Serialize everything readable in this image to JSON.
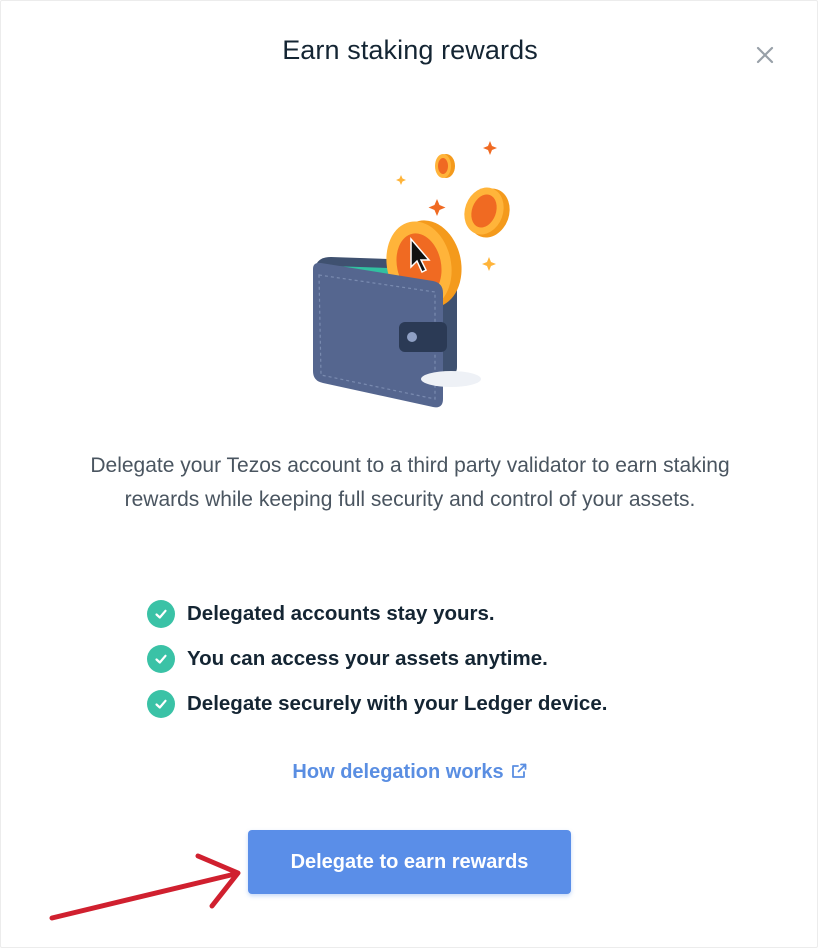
{
  "modal": {
    "title": "Earn staking rewards",
    "close_icon": "close-icon",
    "illustration_icon": "wallet-with-coins-icon",
    "description": "Delegate your Tezos account to a third party validator to earn staking rewards while keeping full security and control of your assets.",
    "features": [
      {
        "label": "Delegated accounts stay yours.",
        "icon": "check-circle-icon"
      },
      {
        "label": "You can access your assets anytime.",
        "icon": "check-circle-icon"
      },
      {
        "label": "Delegate securely with your Ledger device.",
        "icon": "check-circle-icon"
      }
    ],
    "link_label": "How delegation works",
    "link_icon": "external-link-icon",
    "cta_label": "Delegate to earn rewards"
  },
  "annotation": {
    "icon": "red-arrow-icon",
    "color": "#d0202f"
  },
  "colors": {
    "accent": "#5a8ee8",
    "check": "#3ac2a6",
    "title": "#142533"
  }
}
